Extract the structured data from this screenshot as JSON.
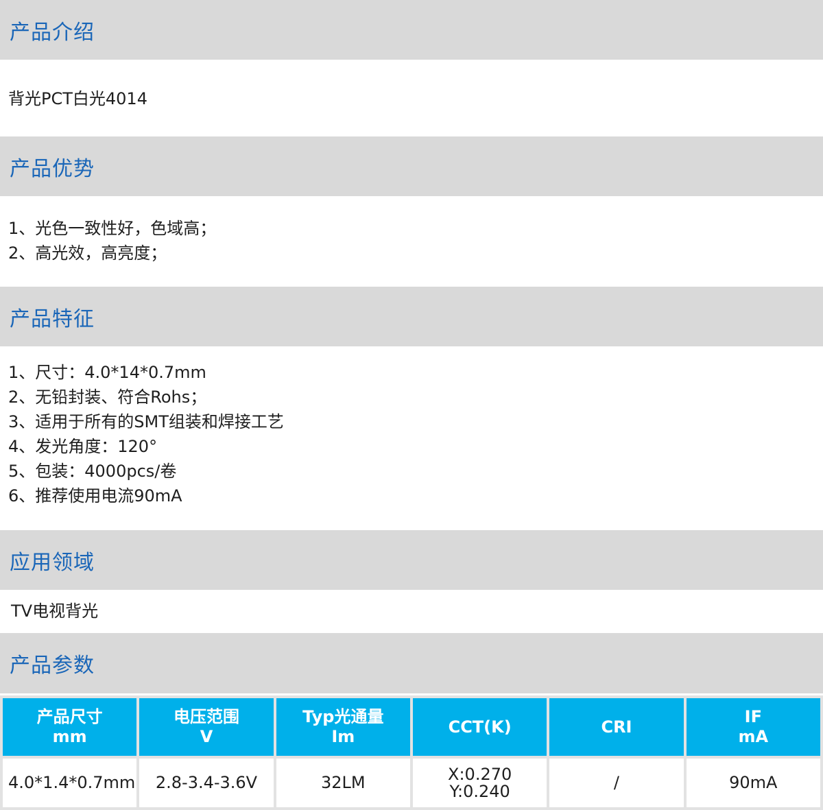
{
  "sections": {
    "intro": {
      "title": "产品介绍",
      "lines": [
        "背光PCT白光4014"
      ]
    },
    "advantages": {
      "title": "产品优势",
      "lines": [
        "1、光色一致性好，色域高；",
        "2、高光效，高亮度；"
      ]
    },
    "features": {
      "title": "产品特征",
      "lines": [
        "1、尺寸：4.0*14*0.7mm",
        "2、无铅封装、符合Rohs；",
        "3、适用于所有的SMT组装和焊接工艺",
        "4、发光角度：120°",
        "5、包装：4000pcs/卷",
        "6、推荐使用电流90mA"
      ]
    },
    "applications": {
      "title": "应用领域",
      "lines": [
        "TV电视背光"
      ]
    },
    "params": {
      "title": "产品参数"
    }
  },
  "table": {
    "headers": [
      [
        "产品尺寸",
        "mm"
      ],
      [
        "电压范围",
        "V"
      ],
      [
        "Typ光通量",
        "Im"
      ],
      [
        "CCT(K)"
      ],
      [
        "CRI"
      ],
      [
        "IF",
        "mA"
      ]
    ],
    "row": [
      [
        "4.0*1.4*0.7mm"
      ],
      [
        "2.8-3.4-3.6V"
      ],
      [
        "32LM"
      ],
      [
        "X:0.270",
        "Y:0.240"
      ],
      [
        "/"
      ],
      [
        "90mA"
      ]
    ]
  }
}
